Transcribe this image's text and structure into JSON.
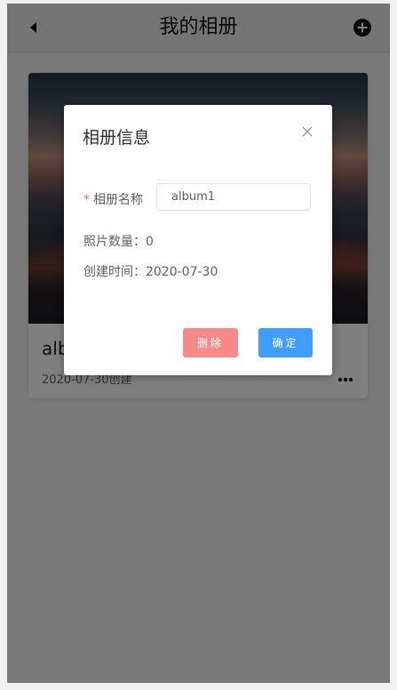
{
  "header": {
    "title": "我的相册",
    "back_icon": "back-arrow-icon",
    "add_icon": "plus-circle-icon"
  },
  "album_card": {
    "name": "album1",
    "date": "2020-07-30创建",
    "more_icon": "more-dots-icon"
  },
  "dialog": {
    "title": "相册信息",
    "close_icon": "close-icon",
    "name_label": "相册名称",
    "required_mark": "*",
    "name_value": "album1",
    "photo_count": "照片数量：0",
    "create_time": "创建时间：2020-07-30",
    "delete_label": "删除",
    "confirm_label": "确定"
  },
  "colors": {
    "primary": "#409eff",
    "danger": "#f78989",
    "required": "#f56c6c",
    "overlay": "rgba(0,0,0,0.5)"
  }
}
